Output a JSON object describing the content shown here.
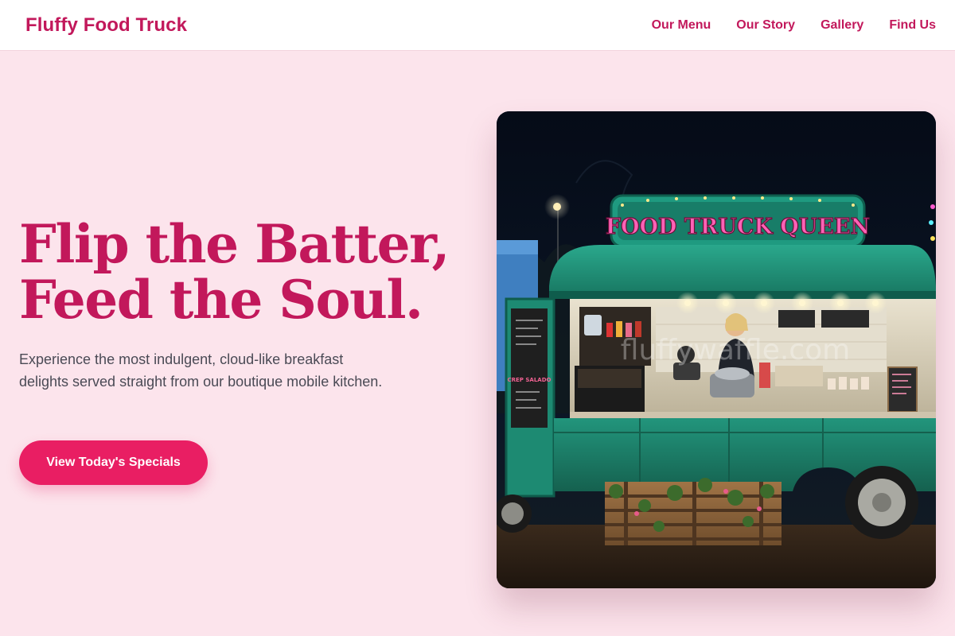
{
  "header": {
    "brand": "Fluffy Food Truck",
    "nav": [
      {
        "label": "Our Menu"
      },
      {
        "label": "Our Story"
      },
      {
        "label": "Gallery"
      },
      {
        "label": "Find Us"
      }
    ]
  },
  "hero": {
    "title_line_1": "Flip the Batter,",
    "title_line_2": "Feed the Soul.",
    "description": "Experience the most indulgent, cloud-like breakfast delights served straight from our boutique mobile kitchen.",
    "cta_label": "View Today's Specials",
    "image": {
      "sign_text": "FOOD TRUCK QUEEN",
      "menu_board_text": "CREP SALADO",
      "watermark_text": "fluffywaffle.com"
    }
  },
  "colors": {
    "brand": "#c2185b",
    "accent": "#e91e63",
    "background": "#fce4ec",
    "truck_teal": "#1f8f78"
  }
}
